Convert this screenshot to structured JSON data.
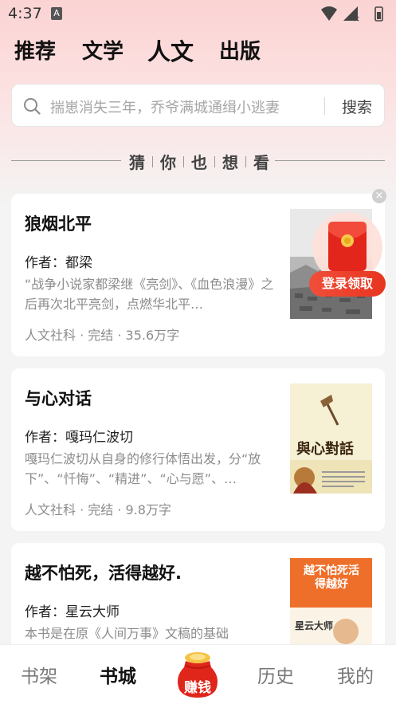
{
  "status_bar": {
    "time": "4:37",
    "notif_letter": "A"
  },
  "top_tabs": [
    {
      "label": "推荐"
    },
    {
      "label": "文学"
    },
    {
      "label": "人文"
    },
    {
      "label": "出版"
    }
  ],
  "search": {
    "placeholder": "揣崽消失三年，乔爷满城通缉小逃妻",
    "button": "搜索"
  },
  "section": {
    "chars": [
      "猜",
      "你",
      "也",
      "想",
      "看"
    ]
  },
  "books": [
    {
      "title": "狼烟北平",
      "author": "作者：都梁",
      "desc": "“战争小说家都梁继《亮剑》、《血色浪漫》之后再次北平亮剑，点燃华北平…",
      "meta": "人文社科 · 完结 · 35.6万字"
    },
    {
      "title": "与心对话",
      "author": "作者：嘎玛仁波切",
      "desc": "嘎玛仁波切从自身的修行体悟出发，分“放下”、“忏悔”、“精进”、“心与愿”、…",
      "meta": "人文社科 · 完结 · 9.8万字",
      "cover_title": "與心對話"
    },
    {
      "title": "越不怕死，活得越好.",
      "author": "作者：星云大师",
      "desc": "本书是在原《人间万事》文稿的基础",
      "cover_title": "越不怕死活得越好",
      "cover_name": "星云大师"
    }
  ],
  "float": {
    "close": "×",
    "label": "登录领取"
  },
  "bottom_nav": [
    {
      "label": "书架"
    },
    {
      "label": "书城"
    },
    {
      "label": "赚钱"
    },
    {
      "label": "历史"
    },
    {
      "label": "我的"
    }
  ]
}
